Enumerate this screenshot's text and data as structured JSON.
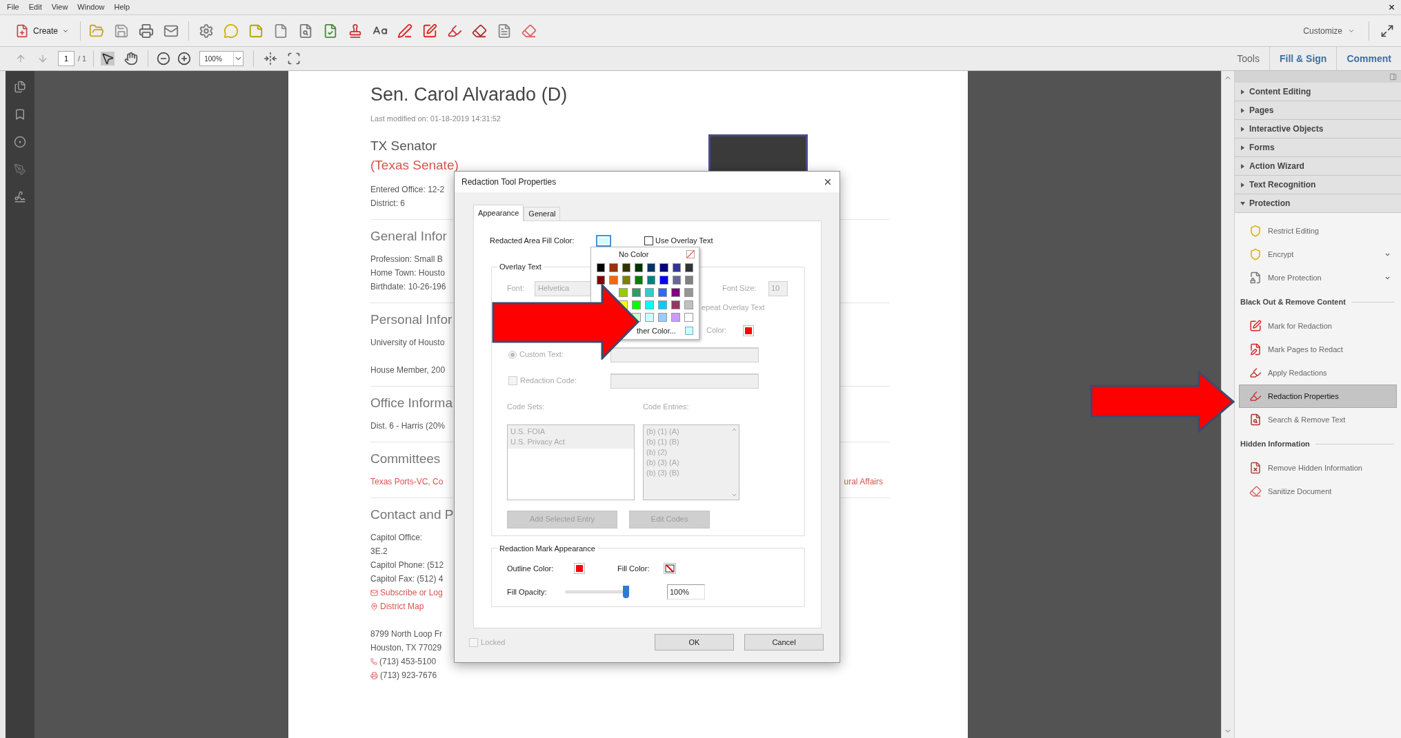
{
  "menu_bar": [
    "File",
    "Edit",
    "View",
    "Window",
    "Help"
  ],
  "toolbar": {
    "create": "Create",
    "customize": "Customize"
  },
  "page_nav": {
    "page": "1",
    "page_count": "/ 1",
    "zoom": "100%"
  },
  "tool_tabs": [
    {
      "label": "Tools",
      "kind": "plain"
    },
    {
      "label": "Fill & Sign",
      "kind": "pane"
    },
    {
      "label": "Comment",
      "kind": "pane"
    }
  ],
  "document": {
    "title": "Sen. Carol Alvarado (D)",
    "modified": "Last modified on: 01-18-2019 14:31:52",
    "role": "TX Senator",
    "chamber": "(Texas Senate)",
    "sections": [
      {
        "paragraphs": [
          [
            {
              "kind": "text",
              "text": "Entered Office: 12-2"
            },
            {
              "kind": "text",
              "text": "District: 6"
            }
          ]
        ]
      },
      {
        "heading": "General Infor",
        "paragraphs": [
          [
            {
              "kind": "text",
              "text": "Profession: Small B"
            },
            {
              "kind": "text",
              "text": "Home Town: Housto"
            },
            {
              "kind": "text",
              "text": "Birthdate: 10-26-196"
            }
          ]
        ]
      },
      {
        "heading": "Personal Infor",
        "paragraphs": [
          [
            {
              "kind": "text",
              "text": "University of Housto"
            }
          ],
          [
            {
              "kind": "text",
              "text": "House Member, 200"
            }
          ]
        ]
      },
      {
        "heading": "Office Informa",
        "paragraphs": [
          [
            {
              "kind": "text",
              "text": "Dist. 6 - Harris (20%"
            }
          ]
        ]
      },
      {
        "heading": "Committees",
        "paragraphs": [
          [
            {
              "kind": "red-text",
              "text": "Texas Ports-VC, Co",
              "tail": "ural Affairs"
            }
          ]
        ]
      },
      {
        "heading": "Contact and P",
        "paragraphs": [
          [
            {
              "kind": "text",
              "text": "Capitol Office:"
            },
            {
              "kind": "text",
              "text": "3E.2"
            },
            {
              "kind": "text",
              "text": "Capitol Phone: (512"
            },
            {
              "kind": "text",
              "text": "Capitol Fax: (512) 4"
            },
            {
              "kind": "email-link",
              "text": "Subscribe or Log"
            },
            {
              "kind": "map-link",
              "text": "District Map"
            }
          ],
          [
            {
              "kind": "text",
              "text": "8799 North Loop Fr"
            },
            {
              "kind": "text",
              "text": "Houston, TX 77029"
            },
            {
              "kind": "phone",
              "text": "(713) 453-5100"
            },
            {
              "kind": "fax",
              "text": "(713) 923-7676"
            }
          ]
        ]
      }
    ]
  },
  "dialog": {
    "title": "Redaction Tool Properties",
    "tabs": [
      {
        "label": "Appearance",
        "selected": true
      },
      {
        "label": "General",
        "selected": false
      }
    ],
    "fill_color_label": "Redacted Area Fill Color:",
    "use_overlay": {
      "label": "Use Overlay Text",
      "checked": false
    },
    "overlay": {
      "legend": "Overlay Text",
      "disabled": true,
      "font_label": "Font:",
      "font": "Helvetica",
      "font_size_label": "Font Size:",
      "font_size": "10",
      "repeat_label": "epeat Overlay Text",
      "color_label": "Color:",
      "custom_text": {
        "label": "Custom Text:",
        "selected": true
      },
      "redaction_code": {
        "label": "Redaction Code:",
        "checked": false
      },
      "code_sets_label": "Code Sets:",
      "code_sets": [
        "U.S. FOIA",
        "U.S. Privacy Act"
      ],
      "code_entries_label": "Code Entries:",
      "code_entries": [
        "(b) (1) (A)",
        "(b) (1) (B)",
        "(b) (2)",
        "(b) (3) (A)",
        "(b) (3) (B)"
      ],
      "buttons": [
        "Add Selected Entry",
        "Edit Codes"
      ]
    },
    "mark": {
      "legend": "Redaction Mark Appearance",
      "outline_label": "Outline Color:",
      "fill_label": "Fill Color:",
      "opacity_label": "Fill Opacity:",
      "level": 1,
      "opacity": "100%"
    },
    "locked": {
      "label": "Locked",
      "checked": false
    },
    "buttons": [
      "OK",
      "Cancel"
    ]
  },
  "color_popup": {
    "no_color": "No Color",
    "other": "ther Color...",
    "swatch_rows": [
      [
        {
          "color": "#000000"
        },
        {
          "color": "#993300"
        },
        {
          "color": "#333300"
        },
        {
          "color": "#003300"
        },
        {
          "color": "#003366"
        },
        {
          "color": "#000080"
        },
        {
          "color": "#333399"
        },
        {
          "color": "#333333"
        }
      ],
      [
        {
          "color": "#800000"
        },
        {
          "color": "#ff6600"
        },
        {
          "color": "#808000"
        },
        {
          "color": "#008000"
        },
        {
          "color": "#008080"
        },
        {
          "color": "#0000ff"
        },
        {
          "color": "#666699"
        },
        {
          "color": "#808080"
        }
      ],
      [
        {
          "color": "#99cc00"
        },
        {
          "color": "#339966"
        },
        {
          "color": "#33cccc"
        },
        {
          "color": "#3366ff"
        },
        {
          "color": "#800080"
        },
        {
          "color": "#969696"
        }
      ],
      [
        {
          "color": "#ffff00"
        },
        {
          "color": "#00ff00"
        },
        {
          "color": "#00ffff"
        },
        {
          "color": "#00ccff"
        },
        {
          "color": "#993366"
        },
        {
          "color": "#c0c0c0"
        }
      ],
      [
        {
          "color": "#ccffcc"
        },
        {
          "color": "#ccffff"
        },
        {
          "color": "#99ccff"
        },
        {
          "color": "#cc99ff"
        },
        {
          "color": "#ffffff"
        }
      ]
    ]
  },
  "panel": {
    "sections": [
      {
        "label": "Content Editing",
        "expanded": false
      },
      {
        "label": "Pages",
        "expanded": false
      },
      {
        "label": "Interactive Objects",
        "expanded": false
      },
      {
        "label": "Forms",
        "expanded": false
      },
      {
        "label": "Action Wizard",
        "expanded": false
      },
      {
        "label": "Text Recognition",
        "expanded": false
      },
      {
        "label": "Protection",
        "expanded": true,
        "items": [
          {
            "kind": "tool",
            "label": "Restrict Editing",
            "selected": false,
            "menu": false
          },
          {
            "kind": "tool",
            "label": "Encrypt",
            "selected": false,
            "menu": true
          },
          {
            "kind": "tool",
            "label": "More Protection",
            "selected": false,
            "menu": true
          },
          {
            "kind": "heading",
            "label": "Black Out & Remove Content"
          },
          {
            "kind": "tool",
            "label": "Mark for Redaction",
            "selected": false,
            "menu": false
          },
          {
            "kind": "tool",
            "label": "Mark Pages to Redact",
            "selected": false,
            "menu": false
          },
          {
            "kind": "tool",
            "label": "Apply Redactions",
            "selected": false,
            "menu": false
          },
          {
            "kind": "tool",
            "label": "Redaction Properties",
            "selected": true,
            "menu": false
          },
          {
            "kind": "tool",
            "label": "Search & Remove Text",
            "selected": false,
            "menu": false
          },
          {
            "kind": "heading",
            "label": "Hidden Information"
          },
          {
            "kind": "tool",
            "label": "Remove Hidden Information",
            "selected": false,
            "menu": false
          },
          {
            "kind": "tool",
            "label": "Sanitize Document",
            "selected": false,
            "menu": false
          }
        ]
      }
    ]
  }
}
